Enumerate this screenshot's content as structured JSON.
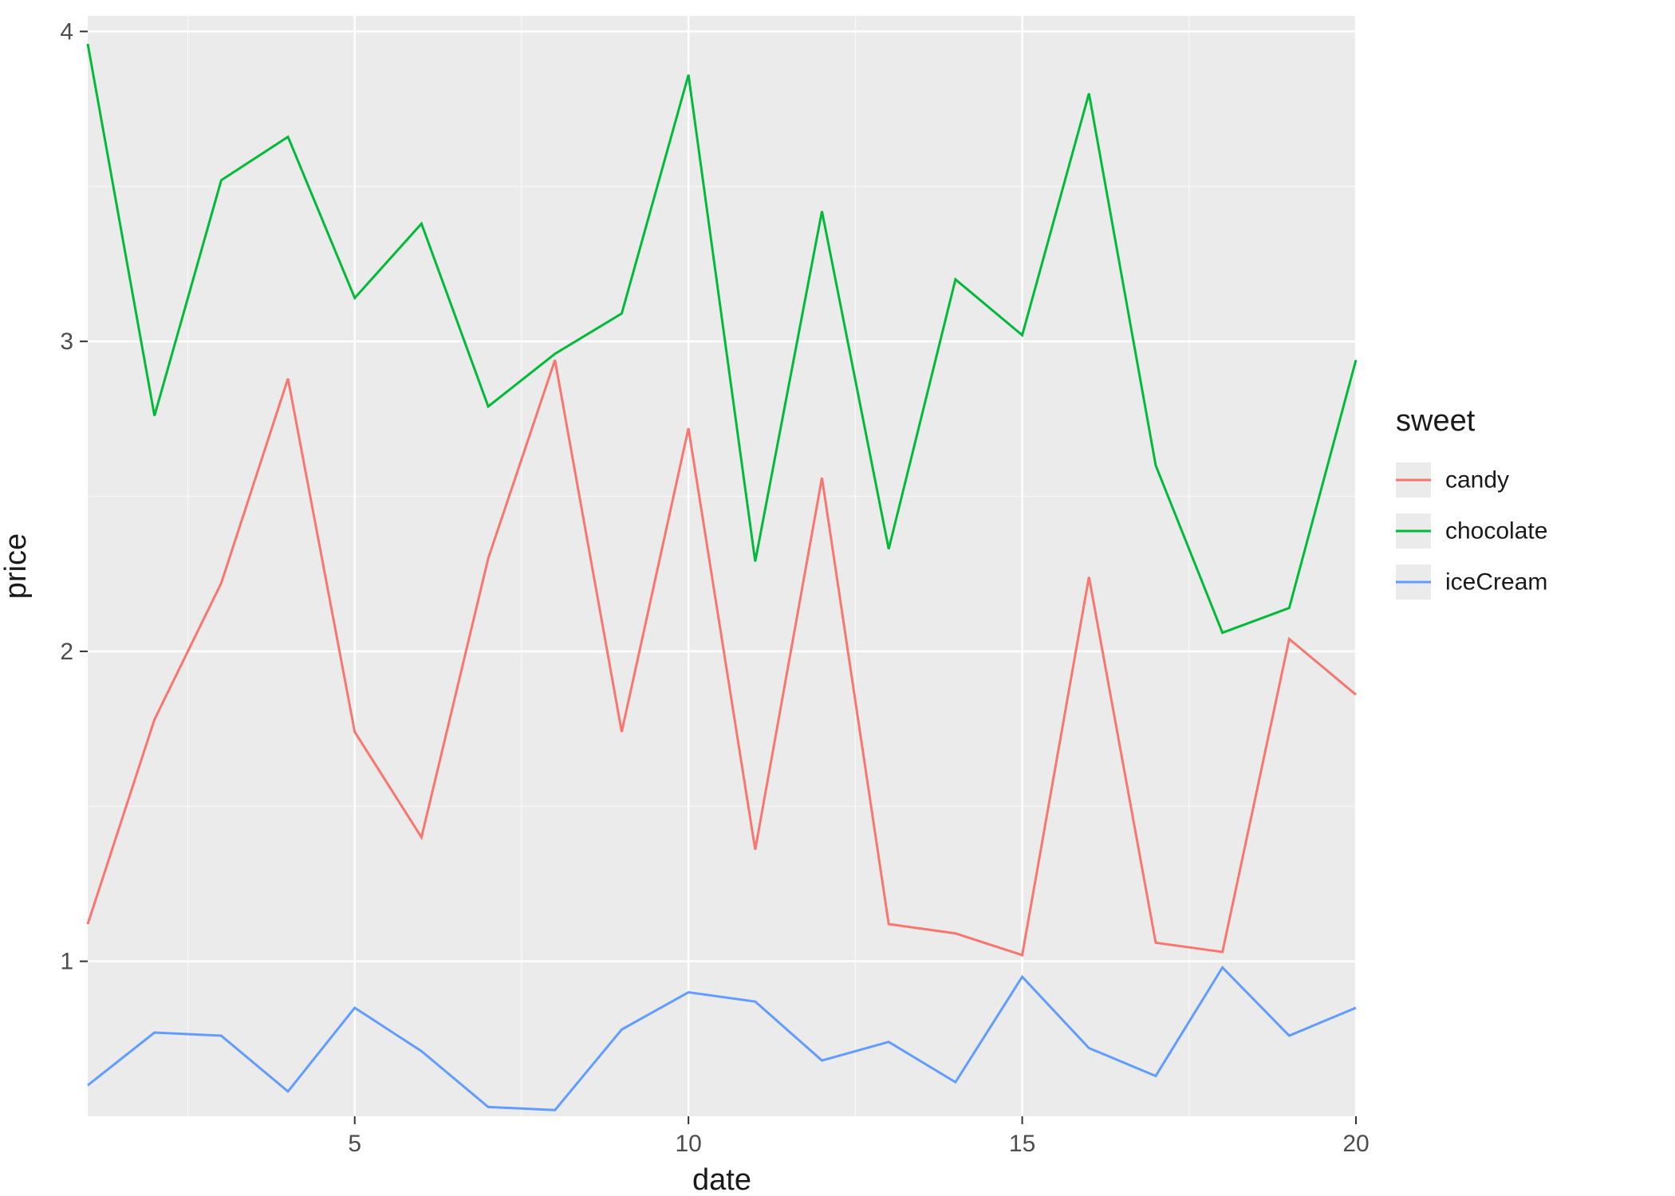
{
  "chart_data": {
    "type": "line",
    "xlabel": "date",
    "ylabel": "price",
    "xlim": [
      1,
      20
    ],
    "ylim": [
      0.5,
      4.05
    ],
    "x_ticks": [
      5,
      10,
      15,
      20
    ],
    "y_ticks": [
      1,
      2,
      3,
      4
    ],
    "grid": true,
    "legend_title": "sweet",
    "legend_position": "right",
    "x": [
      1,
      2,
      3,
      4,
      5,
      6,
      7,
      8,
      9,
      10,
      11,
      12,
      13,
      14,
      15,
      16,
      17,
      18,
      19,
      20
    ],
    "series": [
      {
        "name": "candy",
        "color": "#F8766D",
        "values": [
          1.12,
          1.78,
          2.22,
          2.88,
          1.74,
          1.4,
          2.3,
          2.94,
          1.74,
          2.72,
          1.36,
          2.56,
          1.12,
          1.09,
          1.02,
          2.24,
          1.06,
          1.03,
          2.04,
          1.86
        ]
      },
      {
        "name": "chocolate",
        "color": "#00BA38",
        "values": [
          3.96,
          2.76,
          3.52,
          3.66,
          3.14,
          3.38,
          2.79,
          2.96,
          3.09,
          3.86,
          2.29,
          3.42,
          2.33,
          3.2,
          3.02,
          3.8,
          2.6,
          2.06,
          2.14,
          2.94
        ]
      },
      {
        "name": "iceCream",
        "color": "#619CFF",
        "values": [
          0.6,
          0.77,
          0.76,
          0.58,
          0.85,
          0.71,
          0.53,
          0.52,
          0.78,
          0.9,
          0.87,
          0.68,
          0.74,
          0.61,
          0.95,
          0.72,
          0.63,
          0.98,
          0.76,
          0.85
        ]
      }
    ]
  }
}
